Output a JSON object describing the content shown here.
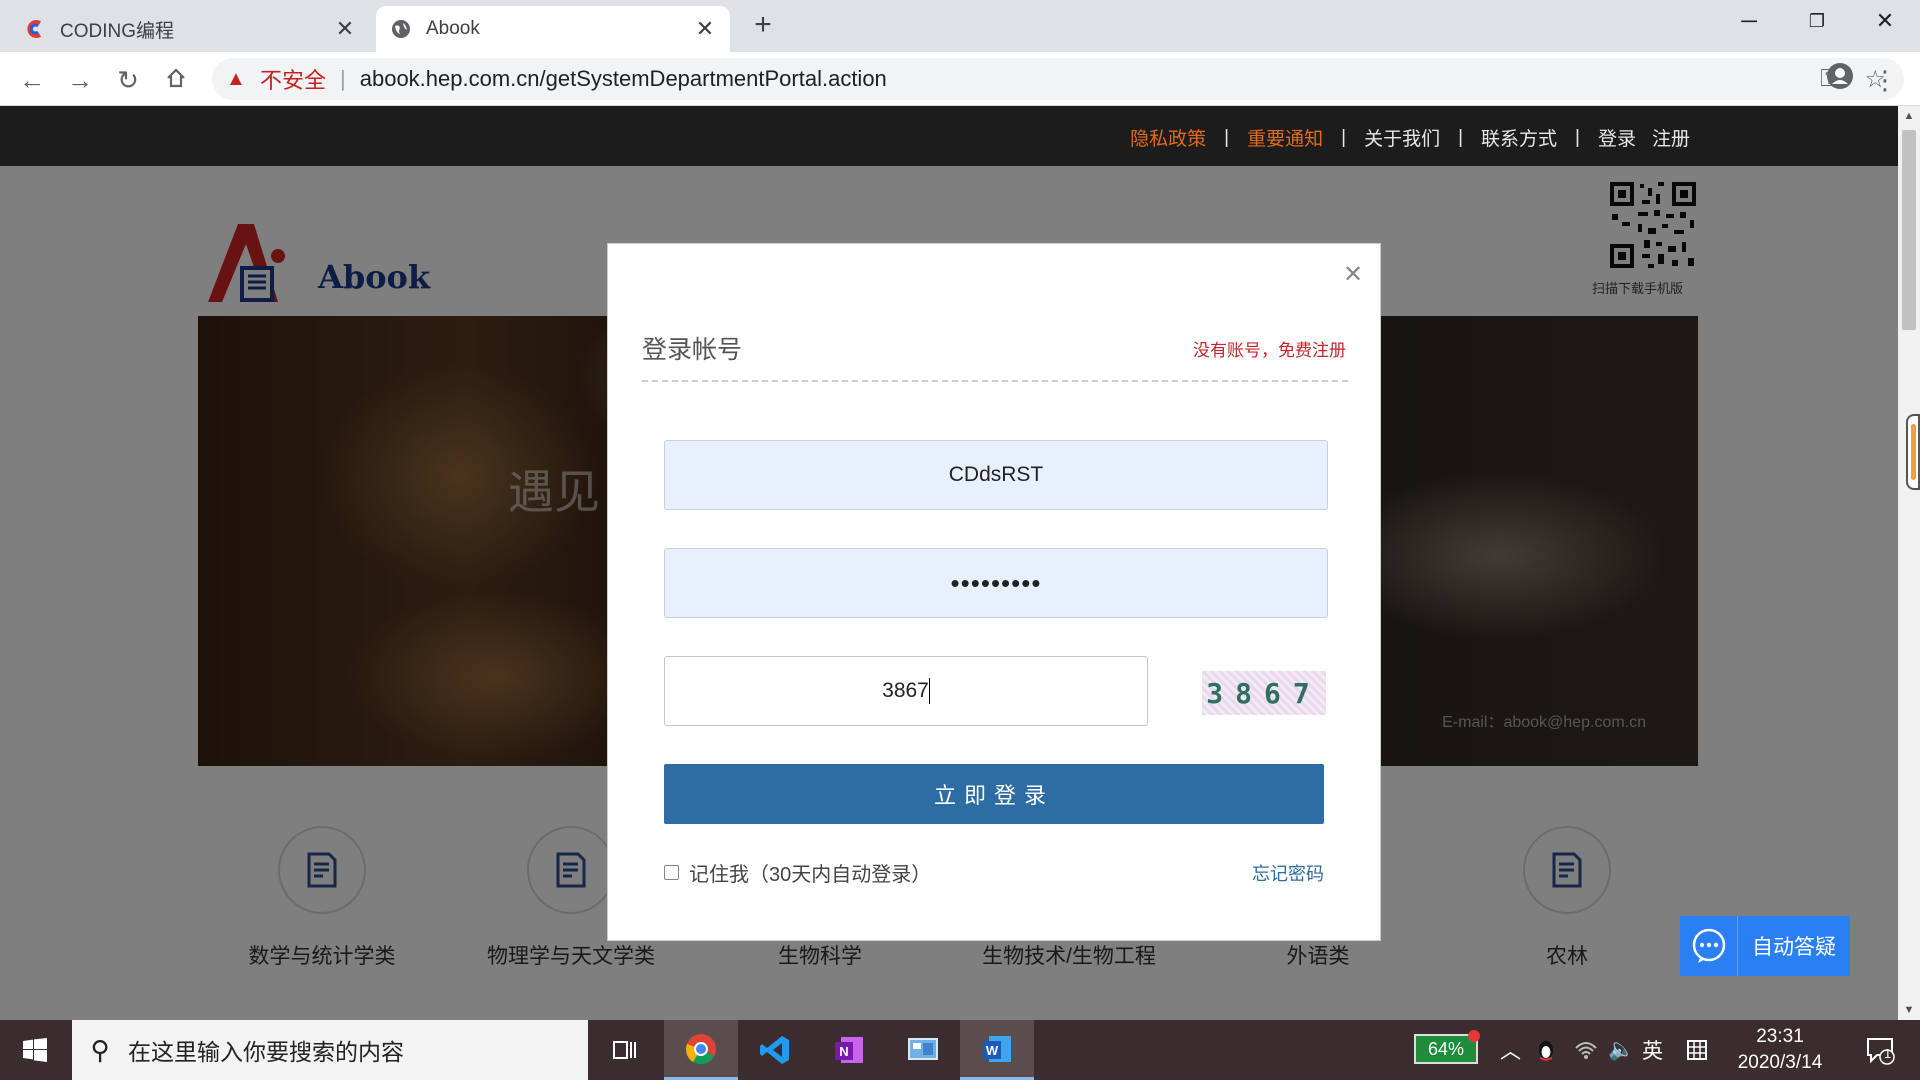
{
  "browser": {
    "tabs": [
      {
        "title": "CODING编程",
        "active": false
      },
      {
        "title": "Abook",
        "active": true
      }
    ],
    "new_tab": "+",
    "security_label": "不安全",
    "url": "abook.hep.com.cn/getSystemDepartmentPortal.action"
  },
  "site": {
    "top_nav": [
      {
        "label": "隐私政策",
        "color": "#e06b1c"
      },
      {
        "label": "重要通知",
        "color": "#e06b1c"
      },
      {
        "label": "关于我们",
        "color": "#e8e8e8"
      },
      {
        "label": "联系方式",
        "color": "#e8e8e8"
      },
      {
        "label": "登录",
        "color": "#e8e8e8"
      },
      {
        "label": "注册",
        "color": "#e8e8e8"
      }
    ],
    "logo_text": "Abook",
    "qr_label": "扫描下载手机版",
    "banner_text": "遇见",
    "banner_email": "E-mail：abook@hep.com.cn",
    "categories": [
      "数学与统计学类",
      "物理学与天文学类",
      "生物科学",
      "生物技术/生物工程",
      "外语类",
      "农林"
    ],
    "chat_button": "自动答疑"
  },
  "login_modal": {
    "title": "登录帐号",
    "register_link": "没有账号，免费注册",
    "username_value": "CDdsRST",
    "password_masked": "•••••••••",
    "captcha_input": "3867",
    "captcha_image_text": "3867",
    "submit_label": "立即登录",
    "remember_label": "记住我（30天内自动登录）",
    "remember_checked": false,
    "forgot_label": "忘记密码"
  },
  "taskbar": {
    "search_placeholder": "在这里输入你要搜索的内容",
    "battery": "64%",
    "ime": "英",
    "time": "23:31",
    "date": "2020/3/14",
    "notification_count": "1"
  }
}
